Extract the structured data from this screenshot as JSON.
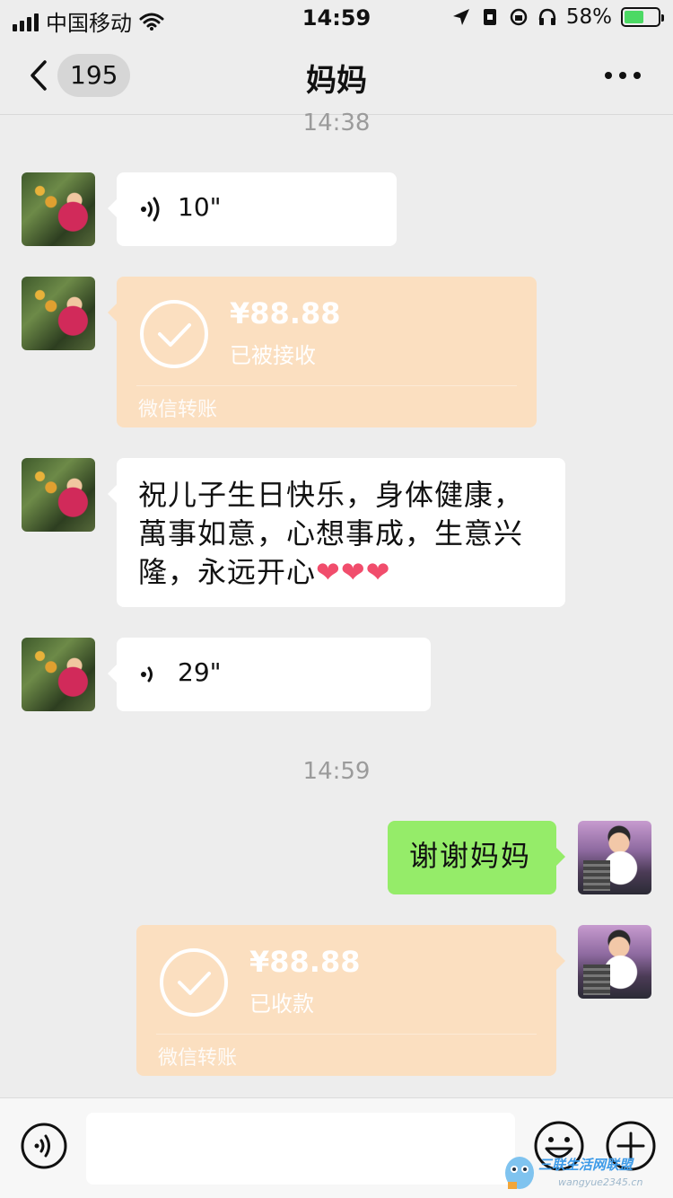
{
  "status_bar": {
    "carrier": "中国移动",
    "time": "14:59",
    "battery_percent": "58%",
    "battery_level": 0.58,
    "icons": [
      "signal-icon",
      "wifi-icon",
      "location-icon",
      "lock-rotation-icon",
      "headphones-icon",
      "battery-icon"
    ]
  },
  "nav": {
    "back_count": "195",
    "title": "妈妈",
    "more_icon": "more-icon"
  },
  "chat": {
    "timestamp_1": "14:38",
    "voice_1": {
      "duration": "10\""
    },
    "transfer_1": {
      "amount": "¥88.88",
      "status": "已被接收",
      "footer": "微信转账"
    },
    "text_1": {
      "line1": "祝儿子生日快乐，身体健康，",
      "line2": "萬事如意，心想事成，生意兴",
      "line3": "隆，永远开心",
      "hearts": "❤❤❤"
    },
    "voice_2": {
      "duration": "29\""
    },
    "timestamp_2": "14:59",
    "reply_1": {
      "text": "谢谢妈妈"
    },
    "transfer_2": {
      "amount": "¥88.88",
      "status": "已收款",
      "footer": "微信转账"
    }
  },
  "input_bar": {
    "value": "",
    "icons": [
      "voice-icon",
      "emoji-icon",
      "plus-icon"
    ]
  },
  "watermark": {
    "text": "三联生活网联盟",
    "sub": "wangyue2345.cn"
  },
  "colors": {
    "background": "#ededed",
    "incoming_bubble": "#ffffff",
    "outgoing_bubble": "#95ec69",
    "transfer_bubble": "#fbdfc0"
  }
}
